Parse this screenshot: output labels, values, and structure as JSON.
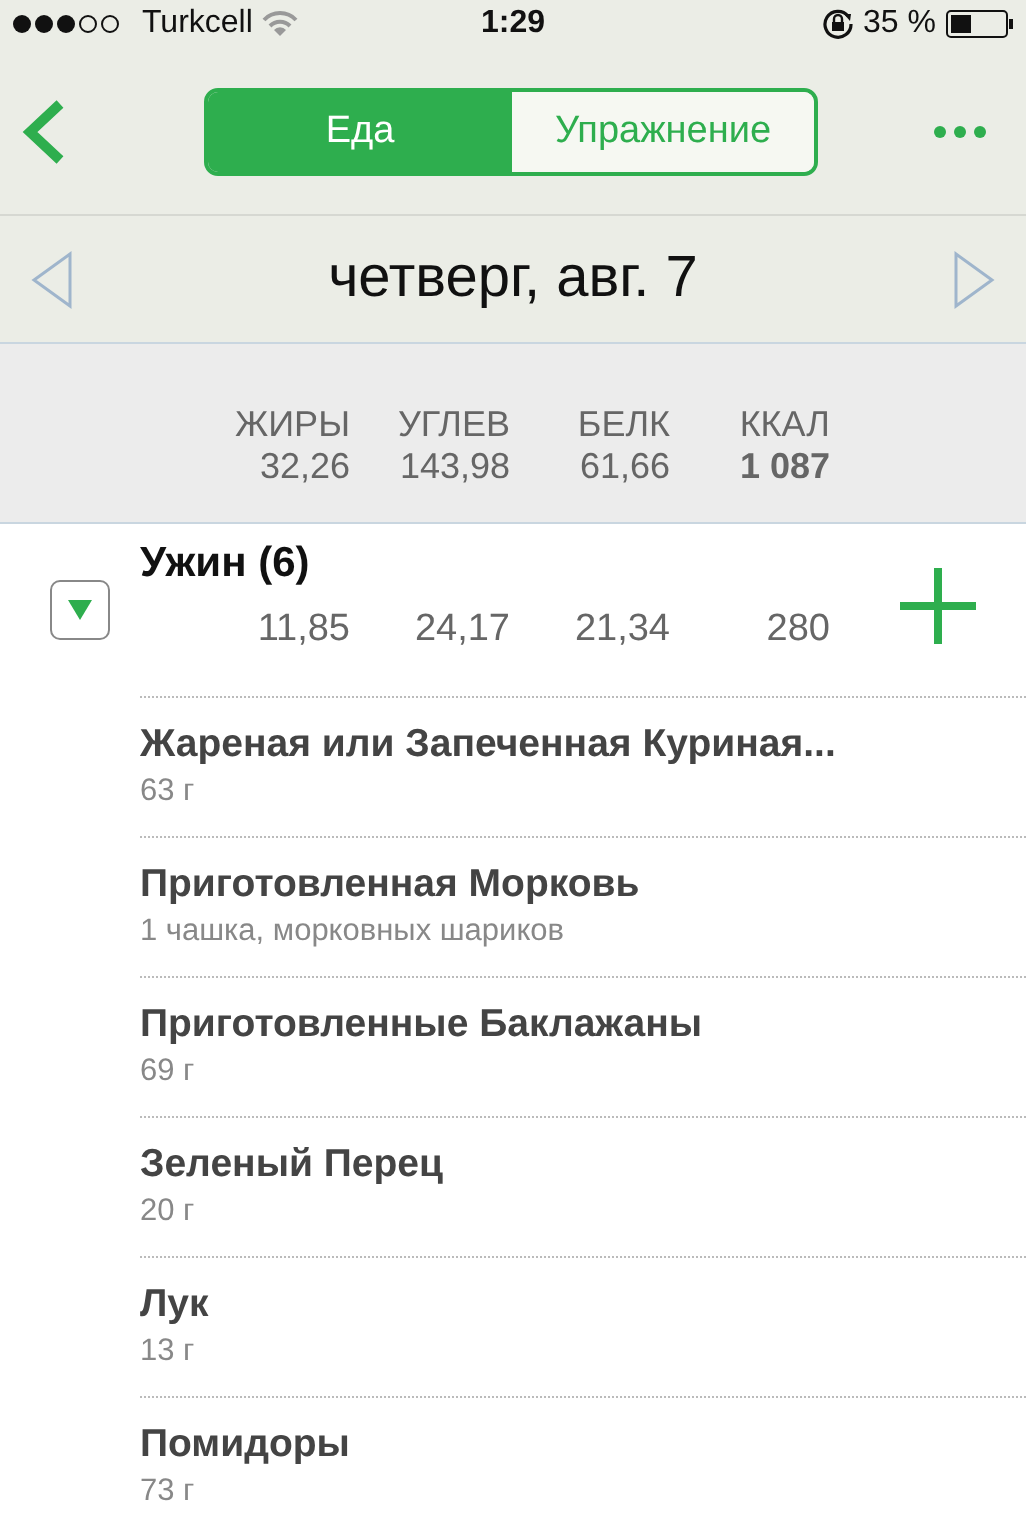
{
  "status_bar": {
    "carrier": "Turkcell",
    "time": "1:29",
    "battery": "35 %"
  },
  "nav": {
    "segments": [
      {
        "label": "Еда",
        "selected": true
      },
      {
        "label": "Упражнение",
        "selected": false
      }
    ]
  },
  "date": "четверг, авг. 7",
  "summary": [
    {
      "label": "ЖИРЫ",
      "value": "32,26",
      "kind": "macro"
    },
    {
      "label": "УГЛЕВ",
      "value": "143,98",
      "kind": "macro"
    },
    {
      "label": "БЕЛК",
      "value": "61,66",
      "kind": "macro"
    },
    {
      "label": "ККАЛ",
      "value": "1 087",
      "kind": "calories"
    }
  ],
  "meal": {
    "title": "Ужин (6)",
    "expanded": true,
    "values": [
      "11,85",
      "24,17",
      "21,34",
      "280"
    ],
    "items": [
      {
        "name": "Жареная или Запеченная Куриная...",
        "amount": "63 г"
      },
      {
        "name": "Приготовленная Морковь",
        "amount": "1 чашка, морковных шариков"
      },
      {
        "name": "Приготовленные Баклажаны",
        "amount": "69 г"
      },
      {
        "name": "Зеленый Перец",
        "amount": "20 г"
      },
      {
        "name": "Лук",
        "amount": "13 г"
      },
      {
        "name": "Помидоры",
        "amount": "73 г"
      }
    ]
  }
}
